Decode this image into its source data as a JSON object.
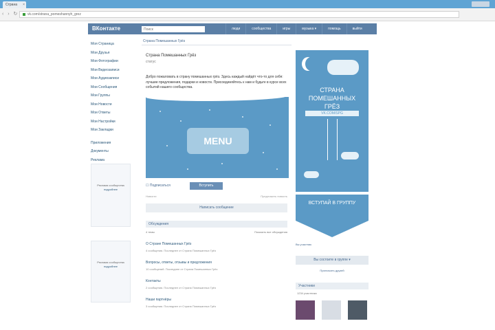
{
  "browser": {
    "tab_title": "Страна",
    "tab_close": "×",
    "nav": "‹ › ↻",
    "url": "vk.com/strana_pomeshannyh_grez"
  },
  "header": {
    "logo": "ВКонтакте",
    "search_placeholder": "Поиск",
    "menu": [
      "люди",
      "сообщества",
      "игры",
      "музыка ▾",
      "помощь",
      "выйти"
    ]
  },
  "left_nav": {
    "items": [
      "Моя Страница",
      "Мои Друзья",
      "Мои Фотографии",
      "Мои Видеозаписи",
      "Мои Аудиозаписи",
      "Мои Сообщения",
      "Мои Группы",
      "Мои Новости",
      "Мои Ответы",
      "Мои Настройки",
      "Мои Закладки"
    ],
    "items2": [
      "Приложения",
      "Документы",
      "Реклама"
    ]
  },
  "ads": [
    {
      "text": "Реклама сообщества",
      "link": "подробнее"
    },
    {
      "text": "Реклама сообщества",
      "link": "подробнее"
    }
  ],
  "main": {
    "breadcrumb": "Страна Помешанных Грёз",
    "group_title": "Страна Помешанных Грёз",
    "status": "статус",
    "description": "Добро пожаловать в страну помешанных грёз. Здесь каждый найдёт что-то для себя: лучшие предложения, подарки и новости. Присоединяйтесь к нам и будьте в курсе всех событий нашего сообщества.",
    "banner_label": "MENU",
    "subscribe": "☐ Подписаться",
    "join_button": "Вступить",
    "meta_left": "Новости",
    "meta_right": "Предложить новость",
    "wide_button": "Написать сообщение",
    "section_head": "Обсуждения",
    "section_sub_left": "4 темы",
    "section_sub_right": "Показать все обсуждения",
    "posts": [
      {
        "title": "О Стране Помешанных Грёз",
        "line": "4 сообщения. Последнее от Страна Помешанных Грёз"
      },
      {
        "title": "Вопросы, ответы, отзывы и предложения",
        "line": "10 сообщений. Последнее от Страна Помешанных Грёз"
      },
      {
        "title": "Контакты",
        "line": "2 сообщения. Последнее от Страна Помешанных Грёз"
      },
      {
        "title": "Наши партнёры",
        "line": "3 сообщения. Последнее от Страна Помешанных Грёз"
      }
    ]
  },
  "right": {
    "poster_title": "СТРАНА ПОМЕШАННЫХ ГРЁЗ",
    "poster_ribbon": "VK.COM/SPG",
    "arrow_text": "ВСТУПАЙ В ГРУППУ",
    "link": "Вы участник",
    "button": "Вы состоите в группе ▾",
    "sub": "Пригласить друзей",
    "followers_head": "Участники",
    "followers_sub": "1234 участника"
  },
  "colors": {
    "vk_blue": "#5b7fa6",
    "sky": "#5b9ac6",
    "link": "#2b587a"
  }
}
